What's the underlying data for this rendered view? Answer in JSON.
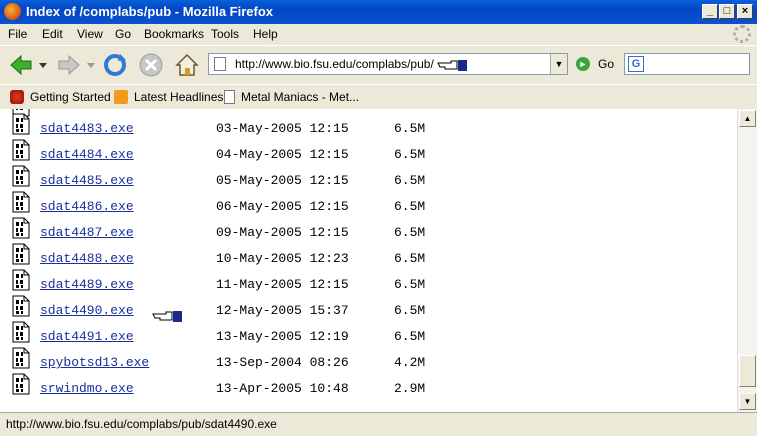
{
  "window": {
    "title": "Index of /complabs/pub - Mozilla Firefox"
  },
  "menu": [
    "File",
    "Edit",
    "View",
    "Go",
    "Bookmarks",
    "Tools",
    "Help"
  ],
  "nav": {
    "url": "http://www.bio.fsu.edu/complabs/pub/",
    "go_label": "Go"
  },
  "bookmarks": [
    "Getting Started",
    "Latest Headlines",
    "Metal Maniacs - Met..."
  ],
  "files": [
    {
      "name": "sdat4483.exe",
      "date": "03-May-2005 12:15",
      "size": "6.5M"
    },
    {
      "name": "sdat4484.exe",
      "date": "04-May-2005 12:15",
      "size": "6.5M"
    },
    {
      "name": "sdat4485.exe",
      "date": "05-May-2005 12:15",
      "size": "6.5M"
    },
    {
      "name": "sdat4486.exe",
      "date": "06-May-2005 12:15",
      "size": "6.5M"
    },
    {
      "name": "sdat4487.exe",
      "date": "09-May-2005 12:15",
      "size": "6.5M"
    },
    {
      "name": "sdat4488.exe",
      "date": "10-May-2005 12:23",
      "size": "6.5M"
    },
    {
      "name": "sdat4489.exe",
      "date": "11-May-2005 12:15",
      "size": "6.5M"
    },
    {
      "name": "sdat4490.exe",
      "date": "12-May-2005 15:37",
      "size": "6.5M"
    },
    {
      "name": "sdat4491.exe",
      "date": "13-May-2005 12:19",
      "size": "6.5M"
    },
    {
      "name": "spybotsd13.exe",
      "date": "13-Sep-2004 08:26",
      "size": "4.2M"
    },
    {
      "name": "srwindmo.exe",
      "date": "13-Apr-2005 10:48",
      "size": "2.9M"
    }
  ],
  "status": {
    "text": "http://www.bio.fsu.edu/complabs/pub/sdat4490.exe"
  }
}
